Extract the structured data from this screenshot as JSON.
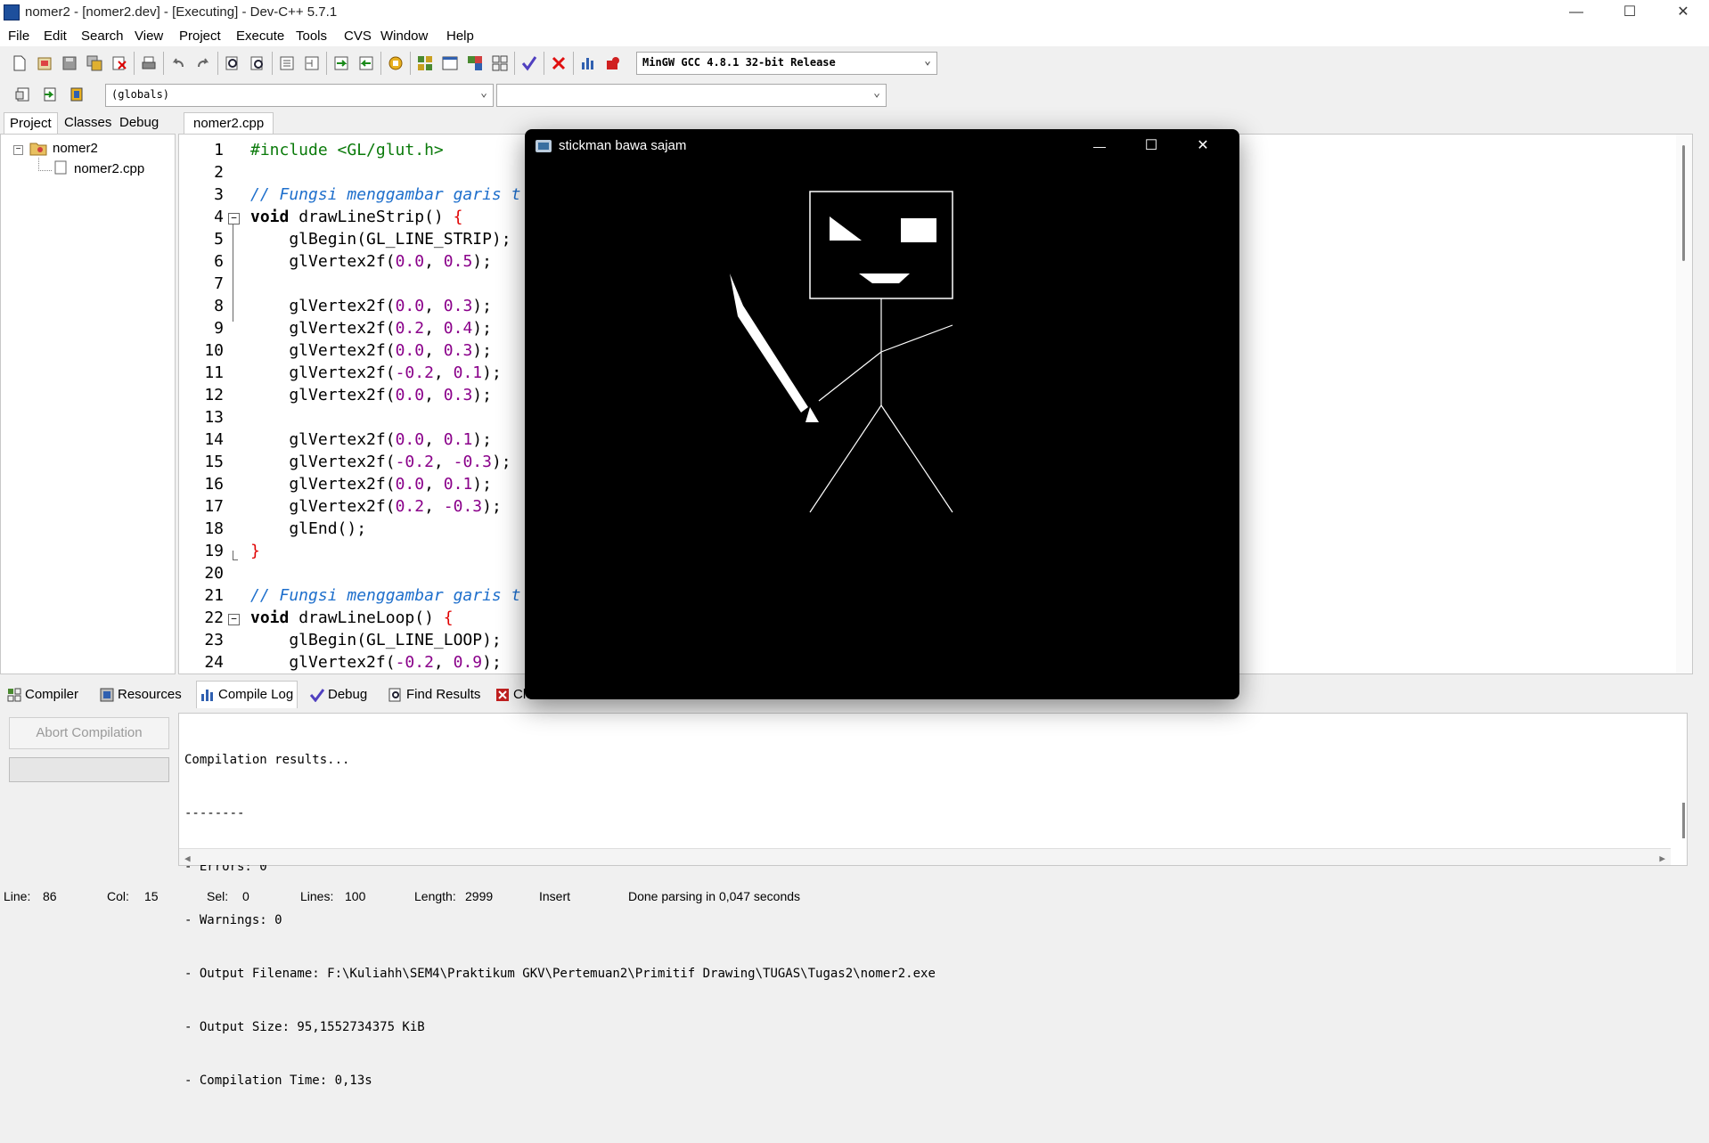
{
  "window": {
    "title": "nomer2 - [nomer2.dev] - [Executing] - Dev-C++ 5.7.1",
    "minimize": "—",
    "maximize": "☐",
    "close": "✕"
  },
  "menu": [
    "File",
    "Edit",
    "Search",
    "View",
    "Project",
    "Execute",
    "Tools",
    "CVS",
    "Window",
    "Help"
  ],
  "toolbar": {
    "compiler_combo": "MinGW GCC 4.8.1 32-bit Release",
    "globals_combo": "(globals)",
    "function_combo": ""
  },
  "left_panel": {
    "tabs": [
      "Project",
      "Classes",
      "Debug"
    ],
    "tree": {
      "project": "nomer2",
      "file": "nomer2.cpp"
    }
  },
  "editor": {
    "tab": "nomer2.cpp",
    "line_numbers": [
      "1",
      "2",
      "3",
      "4",
      "5",
      "6",
      "7",
      "8",
      "9",
      "10",
      "11",
      "12",
      "13",
      "14",
      "15",
      "16",
      "17",
      "18",
      "19",
      "20",
      "21",
      "22",
      "23",
      "24"
    ],
    "lines": {
      "l1": "#include <GL/glut.h>",
      "l3": "// Fungsi menggambar garis t",
      "l4a": "void",
      "l4b": " drawLineStrip() ",
      "l4c": "{",
      "l5a": "    glBegin(GL_LINE_STRIP);",
      "l6a": "    glVertex2f(",
      "l6b": "0.0",
      "l6c": ", ",
      "l6d": "0.5",
      "l6e": ");",
      "l8a": "    glVertex2f(",
      "l8b": "0.0",
      "l8c": ", ",
      "l8d": "0.3",
      "l8e": ");",
      "l9a": "    glVertex2f(",
      "l9b": "0.2",
      "l9c": ", ",
      "l9d": "0.4",
      "l9e": ");",
      "l10a": "    glVertex2f(",
      "l10b": "0.0",
      "l10c": ", ",
      "l10d": "0.3",
      "l10e": ");",
      "l11a": "    glVertex2f(",
      "l11b": "-0.2",
      "l11c": ", ",
      "l11d": "0.1",
      "l11e": ");",
      "l12a": "    glVertex2f(",
      "l12b": "0.0",
      "l12c": ", ",
      "l12d": "0.3",
      "l12e": ");",
      "l14a": "    glVertex2f(",
      "l14b": "0.0",
      "l14c": ", ",
      "l14d": "0.1",
      "l14e": ");",
      "l15a": "    glVertex2f(",
      "l15b": "-0.2",
      "l15c": ", ",
      "l15d": "-0.3",
      "l15e": ");",
      "l16a": "    glVertex2f(",
      "l16b": "0.0",
      "l16c": ", ",
      "l16d": "0.1",
      "l16e": ");",
      "l17a": "    glVertex2f(",
      "l17b": "0.2",
      "l17c": ", ",
      "l17d": "-0.3",
      "l17e": ");",
      "l18a": "    glEnd();",
      "l19": "}",
      "l21": "// Fungsi menggambar garis t",
      "l22a": "void",
      "l22b": " drawLineLoop() ",
      "l22c": "{",
      "l23a": "    glBegin(GL_LINE_LOOP);",
      "l24a": "    glVertex2f(",
      "l24b": "-0.2",
      "l24c": ", ",
      "l24d": "0.9",
      "l24e": ");"
    }
  },
  "bottom_tabs": [
    "Compiler",
    "Resources",
    "Compile Log",
    "Debug",
    "Find Results",
    "Close"
  ],
  "abort_button": "Abort Compilation",
  "log": [
    "Compilation results...",
    "--------",
    "- Errors: 0",
    "- Warnings: 0",
    "- Output Filename: F:\\Kuliahh\\SEM4\\Praktikum GKV\\Pertemuan2\\Primitif Drawing\\TUGAS\\Tugas2\\nomer2.exe",
    "- Output Size: 95,1552734375 KiB",
    "- Compilation Time: 0,13s"
  ],
  "status": {
    "line_label": "Line:",
    "line": "86",
    "col_label": "Col:",
    "col": "15",
    "sel_label": "Sel:",
    "sel": "0",
    "lines_label": "Lines:",
    "lines": "100",
    "length_label": "Length:",
    "length": "2999",
    "mode": "Insert",
    "message": "Done parsing in 0,047 seconds"
  },
  "glut_window": {
    "title": "stickman bawa sajam",
    "minimize": "—",
    "maximize": "☐",
    "close": "✕"
  }
}
